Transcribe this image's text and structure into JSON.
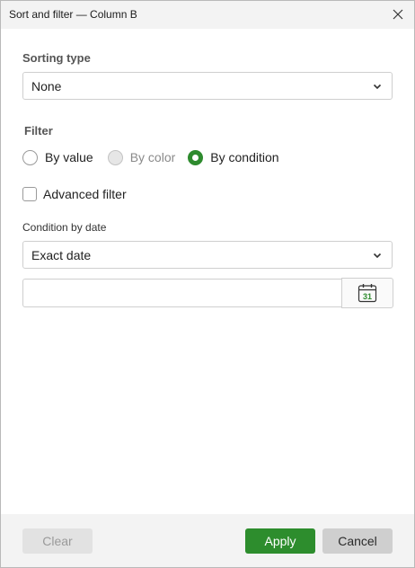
{
  "dialog": {
    "title": "Sort and filter — Column B"
  },
  "sorting": {
    "label": "Sorting type",
    "selected": "None"
  },
  "filter": {
    "label": "Filter",
    "options": [
      {
        "label": "By value",
        "state": "unchecked"
      },
      {
        "label": "By color",
        "state": "disabled"
      },
      {
        "label": "By condition",
        "state": "checked"
      }
    ],
    "advanced_label": "Advanced filter"
  },
  "condition": {
    "label": "Condition by date",
    "selected": "Exact date",
    "date_value": "",
    "calendar_day": "31"
  },
  "footer": {
    "clear_label": "Clear",
    "apply_label": "Apply",
    "cancel_label": "Cancel"
  },
  "colors": {
    "accent": "#2d8d2d",
    "calendar_icon": "#2e8b2e"
  },
  "icons": {
    "close": "close-icon",
    "dropdown": "chevron-down-icon",
    "calendar": "calendar-icon"
  }
}
